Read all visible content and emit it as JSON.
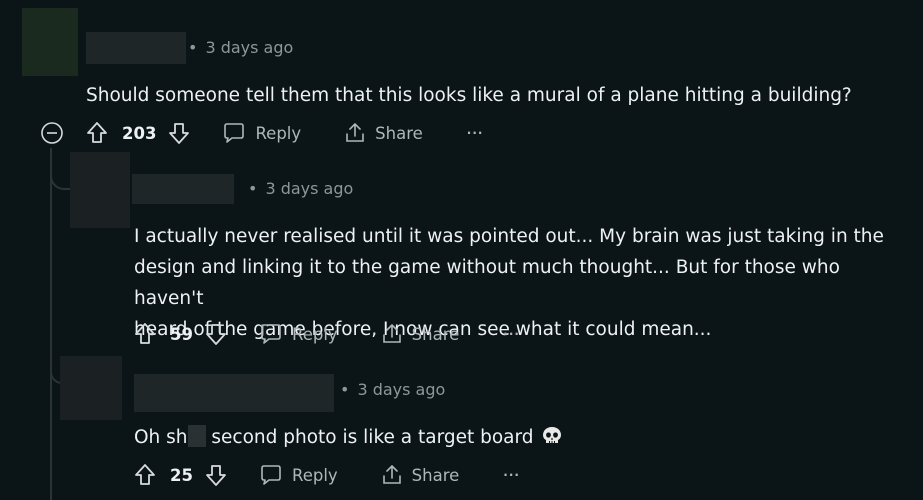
{
  "comments": [
    {
      "time": "3 days ago",
      "text": "Should someone tell them that this looks like a mural of a plane hitting a building?",
      "score": "203",
      "reply": "Reply",
      "share": "Share",
      "more": "···"
    },
    {
      "time": "3 days ago",
      "lines": [
        "I actually never realised until it was pointed out... My brain was just taking in the",
        "design and linking it to the game without much thought... But for those who haven't",
        "heard of the game before, I now can see what it could mean..."
      ],
      "score": "59",
      "reply": "Reply",
      "share": "Share",
      "more": "···"
    },
    {
      "time": "3 days ago",
      "text_before": "Oh sh",
      "text_after": " second photo is like a target board",
      "emoji": "skull-emoji",
      "score": "25",
      "reply": "Reply",
      "share": "Share",
      "more": "···"
    }
  ]
}
